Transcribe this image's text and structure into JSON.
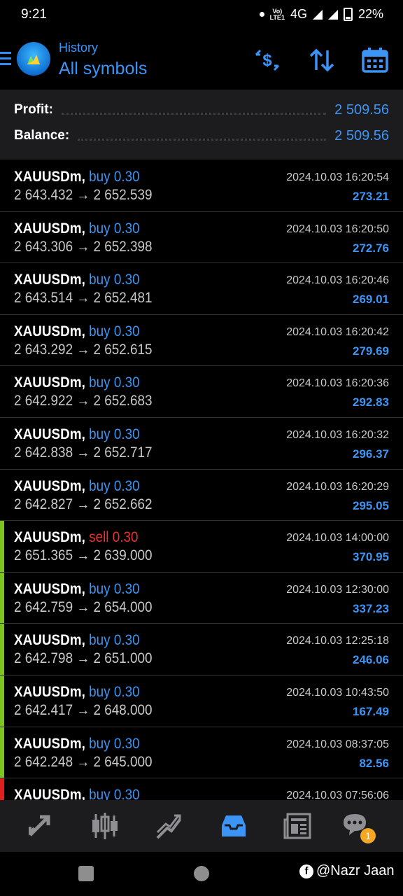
{
  "status_bar": {
    "time": "9:21",
    "network": "4G",
    "volte": "Vo)) LTE1",
    "battery": "22%"
  },
  "header": {
    "title": "History",
    "subtitle": "All symbols"
  },
  "summary": {
    "profit_label": "Profit:",
    "profit_value": "2 509.56",
    "balance_label": "Balance:",
    "balance_value": "2 509.56"
  },
  "trades": [
    {
      "symbol": "XAUUSDm,",
      "type": "buy 0.30",
      "side": "buy",
      "prices": "2 643.432 → 2 652.539",
      "time": "2024.10.03 16:20:54",
      "profit": "273.21",
      "marker": ""
    },
    {
      "symbol": "XAUUSDm,",
      "type": "buy 0.30",
      "side": "buy",
      "prices": "2 643.306 → 2 652.398",
      "time": "2024.10.03 16:20:50",
      "profit": "272.76",
      "marker": ""
    },
    {
      "symbol": "XAUUSDm,",
      "type": "buy 0.30",
      "side": "buy",
      "prices": "2 643.514 → 2 652.481",
      "time": "2024.10.03 16:20:46",
      "profit": "269.01",
      "marker": ""
    },
    {
      "symbol": "XAUUSDm,",
      "type": "buy 0.30",
      "side": "buy",
      "prices": "2 643.292 → 2 652.615",
      "time": "2024.10.03 16:20:42",
      "profit": "279.69",
      "marker": ""
    },
    {
      "symbol": "XAUUSDm,",
      "type": "buy 0.30",
      "side": "buy",
      "prices": "2 642.922 → 2 652.683",
      "time": "2024.10.03 16:20:36",
      "profit": "292.83",
      "marker": ""
    },
    {
      "symbol": "XAUUSDm,",
      "type": "buy 0.30",
      "side": "buy",
      "prices": "2 642.838 → 2 652.717",
      "time": "2024.10.03 16:20:32",
      "profit": "296.37",
      "marker": ""
    },
    {
      "symbol": "XAUUSDm,",
      "type": "buy 0.30",
      "side": "buy",
      "prices": "2 642.827 → 2 652.662",
      "time": "2024.10.03 16:20:29",
      "profit": "295.05",
      "marker": ""
    },
    {
      "symbol": "XAUUSDm,",
      "type": "sell 0.30",
      "side": "sell",
      "prices": "2 651.365 → 2 639.000",
      "time": "2024.10.03 14:00:00",
      "profit": "370.95",
      "marker": "#7cc41f"
    },
    {
      "symbol": "XAUUSDm,",
      "type": "buy 0.30",
      "side": "buy",
      "prices": "2 642.759 → 2 654.000",
      "time": "2024.10.03 12:30:00",
      "profit": "337.23",
      "marker": "#7cc41f"
    },
    {
      "symbol": "XAUUSDm,",
      "type": "buy 0.30",
      "side": "buy",
      "prices": "2 642.798 → 2 651.000",
      "time": "2024.10.03 12:25:18",
      "profit": "246.06",
      "marker": "#7cc41f"
    },
    {
      "symbol": "XAUUSDm,",
      "type": "buy 0.30",
      "side": "buy",
      "prices": "2 642.417 → 2 648.000",
      "time": "2024.10.03 10:43:50",
      "profit": "167.49",
      "marker": "#7cc41f"
    },
    {
      "symbol": "XAUUSDm,",
      "type": "buy 0.30",
      "side": "buy",
      "prices": "2 642.248 → 2 645.000",
      "time": "2024.10.03 08:37:05",
      "profit": "82.56",
      "marker": "#7cc41f"
    },
    {
      "symbol": "XAUUSDm,",
      "type": "buy 0.30",
      "side": "buy",
      "prices": "",
      "time": "2024.10.03 07:56:06",
      "profit": "",
      "marker": "#e02020"
    }
  ],
  "colors": {
    "accent": "#3c95f5",
    "buy": "#3c95f5",
    "sell": "#e8332e",
    "tp_marker": "#7cc41f",
    "sl_marker": "#e02020",
    "badge": "#f5a623"
  },
  "bottom_nav": {
    "items": [
      {
        "icon": "quotes-arrows-icon",
        "active": false
      },
      {
        "icon": "candlestick-chart-icon",
        "active": false
      },
      {
        "icon": "trend-chart-icon",
        "active": false
      },
      {
        "icon": "history-inbox-icon",
        "active": true
      },
      {
        "icon": "news-icon",
        "active": false
      },
      {
        "icon": "chat-icon",
        "active": false
      }
    ],
    "chat_badge": "1"
  },
  "watermark": "@Nazr Jaan"
}
